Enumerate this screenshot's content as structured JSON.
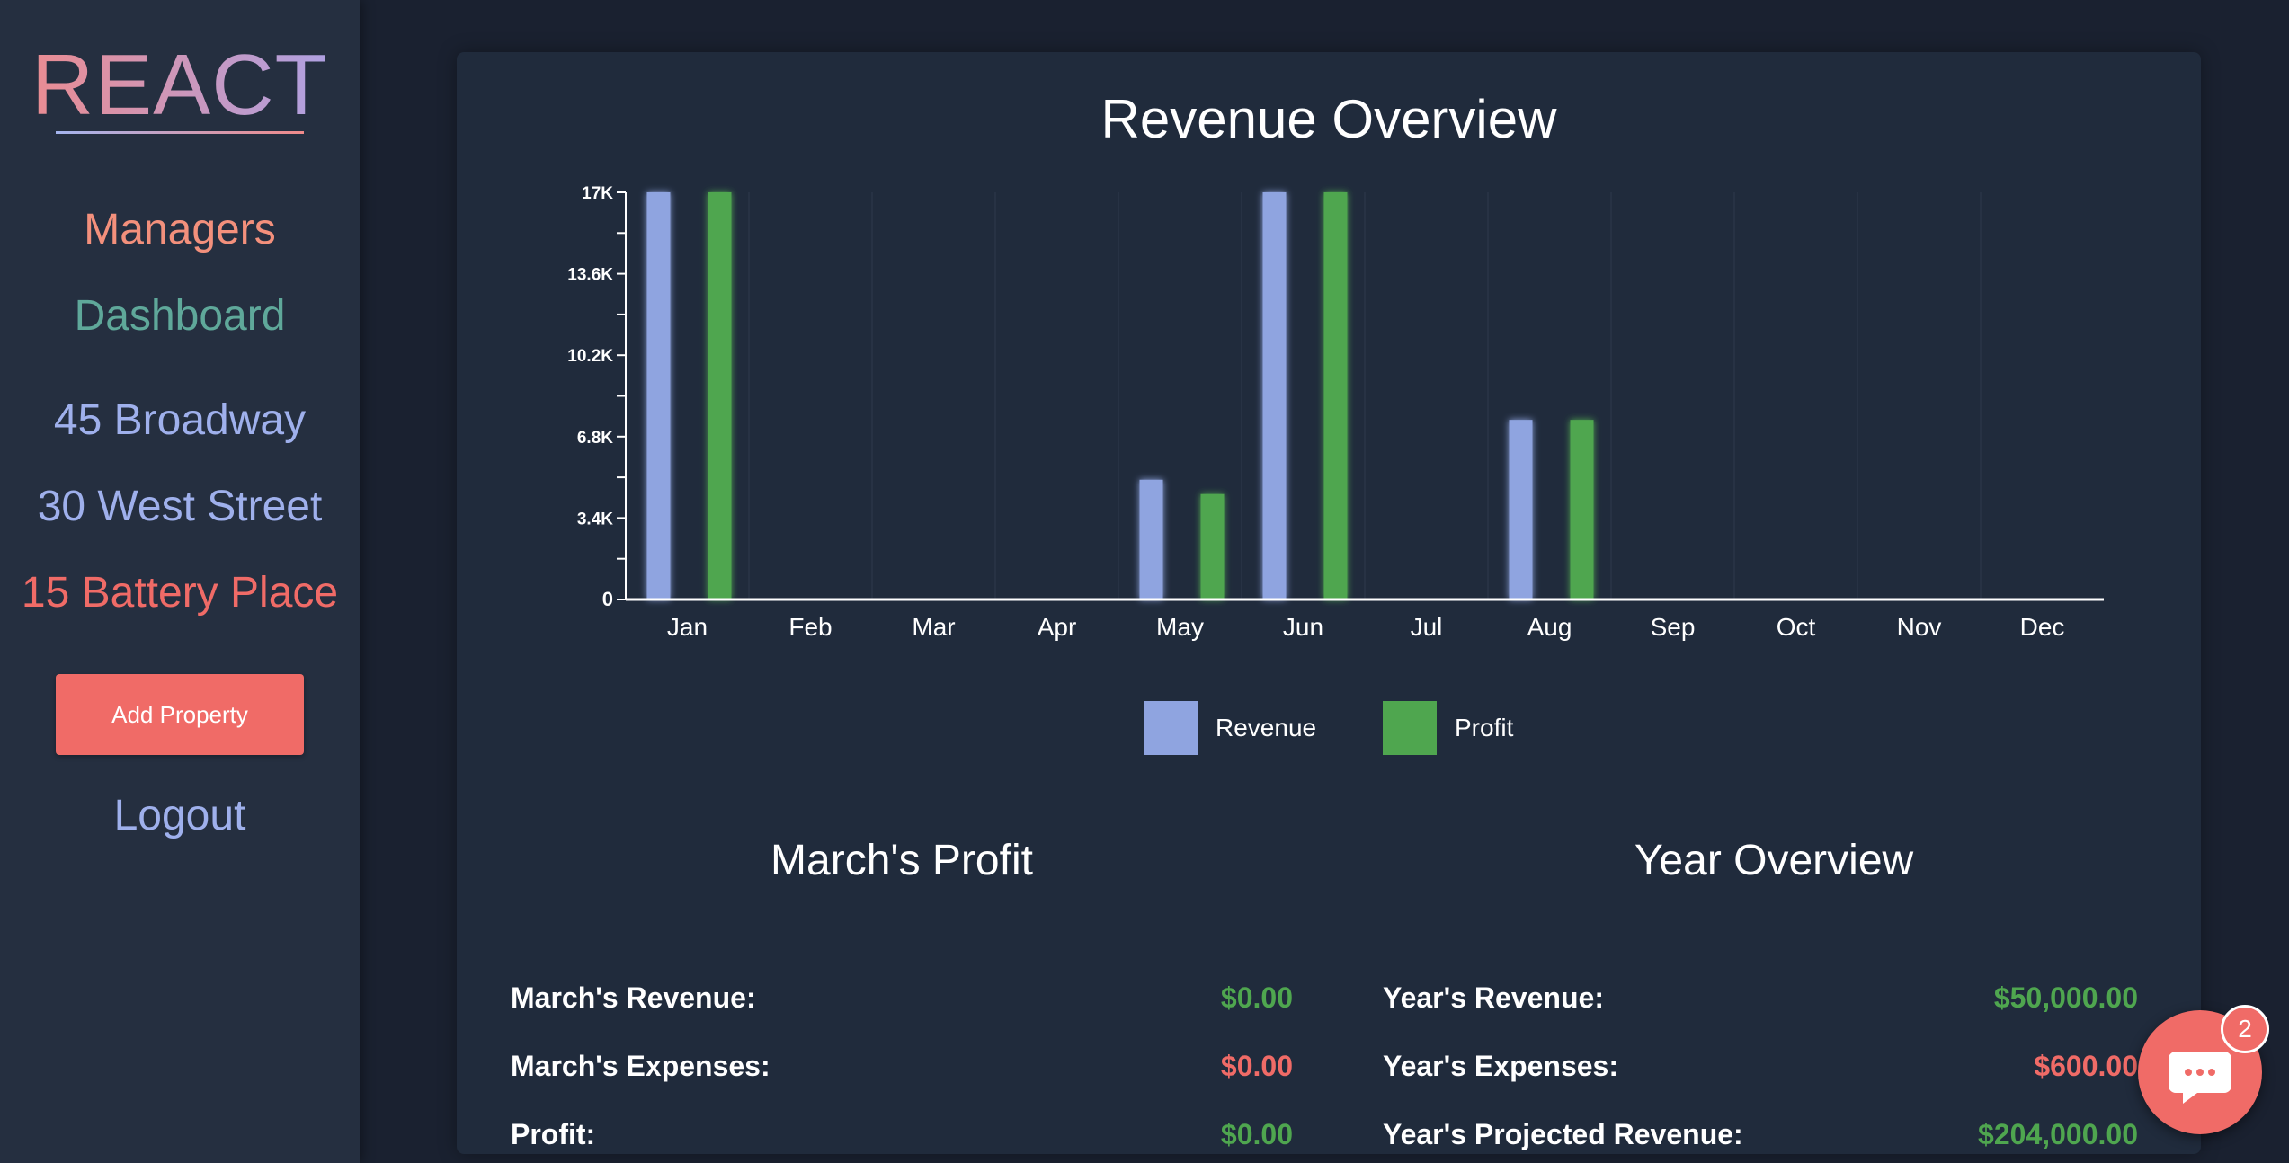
{
  "sidebar": {
    "logo": "REACT",
    "nav": [
      {
        "label": "Managers",
        "color": "#f3907c"
      },
      {
        "label": "Dashboard",
        "color": "#5fa89a"
      },
      {
        "label": "45 Broadway",
        "color": "#9fb0ec"
      },
      {
        "label": "30 West Street",
        "color": "#9fb0ec"
      },
      {
        "label": "15 Battery Place",
        "color": "#f06b67"
      }
    ],
    "add_property": "Add Property",
    "logout": "Logout"
  },
  "chart_data": {
    "type": "bar",
    "title": "Revenue Overview",
    "categories": [
      "Jan",
      "Feb",
      "Mar",
      "Apr",
      "May",
      "Jun",
      "Jul",
      "Aug",
      "Sep",
      "Oct",
      "Nov",
      "Dec"
    ],
    "series": [
      {
        "name": "Revenue",
        "color": "#8fa4e0",
        "values": [
          17000,
          0,
          0,
          0,
          5000,
          17000,
          0,
          7500,
          0,
          0,
          0,
          0
        ]
      },
      {
        "name": "Profit",
        "color": "#4fa64f",
        "values": [
          17000,
          0,
          0,
          0,
          4400,
          17000,
          0,
          7500,
          0,
          0,
          0,
          0
        ]
      }
    ],
    "yticks": [
      "0",
      "3.4K",
      "6.8K",
      "10.2K",
      "13.6K",
      "17K"
    ],
    "ylim": [
      0,
      17000
    ],
    "legend": "bottom"
  },
  "month_summary": {
    "title": "March's Profit",
    "rows": [
      {
        "label": "March's Revenue:",
        "value": "$0.00",
        "color": "#4fa64f"
      },
      {
        "label": "March's Expenses:",
        "value": "$0.00",
        "color": "#f06b67"
      },
      {
        "label": "Profit:",
        "value": "$0.00",
        "color": "#4fa64f"
      }
    ]
  },
  "year_summary": {
    "title": "Year Overview",
    "rows": [
      {
        "label": "Year's Revenue:",
        "value": "$50,000.00",
        "color": "#4fa64f"
      },
      {
        "label": "Year's Expenses:",
        "value": "$600.00",
        "color": "#f06b67"
      },
      {
        "label": "Year's Projected Revenue:",
        "value": "$204,000.00",
        "color": "#4fa64f"
      }
    ]
  },
  "chat": {
    "badge": "2"
  }
}
